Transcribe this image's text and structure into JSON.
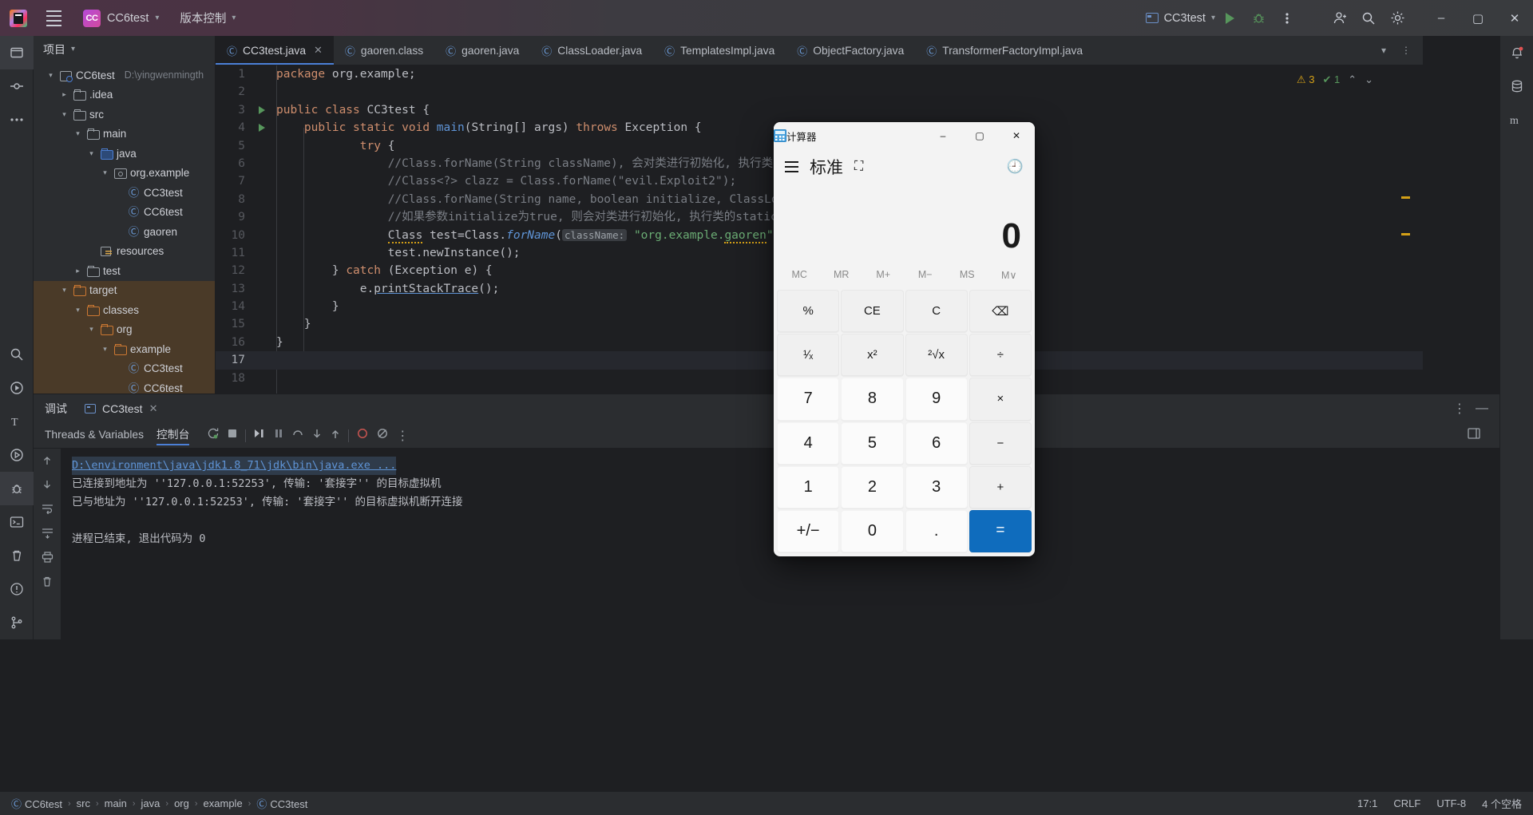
{
  "titlebar": {
    "project_badge": "CC",
    "project_name": "CC6test",
    "vcs_label": "版本控制",
    "run_config": "CC3test",
    "icons": {
      "menu": "hamburger-icon",
      "run": "run-icon",
      "debug": "debug-icon",
      "more": "more-vertical-icon",
      "account": "account-icon",
      "search": "search-icon",
      "settings": "gear-icon",
      "minimize": "–",
      "maximize": "▢",
      "close": "✕"
    }
  },
  "project_panel": {
    "header": "项目",
    "tree": [
      {
        "indent": 0,
        "arrow": "v",
        "icon": "module",
        "label": "CC6test",
        "sub": "D:\\yingwenmingth",
        "highlight": false
      },
      {
        "indent": 1,
        "arrow": ">",
        "icon": "folder",
        "label": ".idea",
        "sub": "",
        "highlight": false
      },
      {
        "indent": 1,
        "arrow": "v",
        "icon": "folder",
        "label": "src",
        "sub": "",
        "highlight": false
      },
      {
        "indent": 2,
        "arrow": "v",
        "icon": "folder",
        "label": "main",
        "sub": "",
        "highlight": false
      },
      {
        "indent": 3,
        "arrow": "v",
        "icon": "folder-blue",
        "label": "java",
        "sub": "",
        "highlight": false
      },
      {
        "indent": 4,
        "arrow": "v",
        "icon": "package",
        "label": "org.example",
        "sub": "",
        "highlight": false
      },
      {
        "indent": 5,
        "arrow": "",
        "icon": "class",
        "label": "CC3test",
        "sub": "",
        "highlight": false
      },
      {
        "indent": 5,
        "arrow": "",
        "icon": "class",
        "label": "CC6test",
        "sub": "",
        "highlight": false
      },
      {
        "indent": 5,
        "arrow": "",
        "icon": "class",
        "label": "gaoren",
        "sub": "",
        "highlight": false
      },
      {
        "indent": 3,
        "arrow": "",
        "icon": "resources",
        "label": "resources",
        "sub": "",
        "highlight": false
      },
      {
        "indent": 2,
        "arrow": ">",
        "icon": "folder",
        "label": "test",
        "sub": "",
        "highlight": false
      },
      {
        "indent": 1,
        "arrow": "v",
        "icon": "folder-orange",
        "label": "target",
        "sub": "",
        "highlight": true
      },
      {
        "indent": 2,
        "arrow": "v",
        "icon": "folder-orange",
        "label": "classes",
        "sub": "",
        "highlight": true
      },
      {
        "indent": 3,
        "arrow": "v",
        "icon": "folder-orange",
        "label": "org",
        "sub": "",
        "highlight": true
      },
      {
        "indent": 4,
        "arrow": "v",
        "icon": "folder-orange",
        "label": "example",
        "sub": "",
        "highlight": true
      },
      {
        "indent": 5,
        "arrow": "",
        "icon": "class",
        "label": "CC3test",
        "sub": "",
        "highlight": true
      },
      {
        "indent": 5,
        "arrow": "",
        "icon": "class",
        "label": "CC6test",
        "sub": "",
        "highlight": true
      }
    ]
  },
  "editor": {
    "tabs": [
      {
        "label": "CC3test.java",
        "active": true,
        "closable": true
      },
      {
        "label": "gaoren.class",
        "active": false,
        "closable": false
      },
      {
        "label": "gaoren.java",
        "active": false,
        "closable": false
      },
      {
        "label": "ClassLoader.java",
        "active": false,
        "closable": false
      },
      {
        "label": "TemplatesImpl.java",
        "active": false,
        "closable": false
      },
      {
        "label": "ObjectFactory.java",
        "active": false,
        "closable": false
      },
      {
        "label": "TransformerFactoryImpl.java",
        "active": false,
        "closable": false
      }
    ],
    "inspections": {
      "warnings": "3",
      "checks": "1"
    },
    "lines": [
      {
        "n": "1",
        "run": false,
        "html": "<span class=\"k\">package</span> org.example;"
      },
      {
        "n": "2",
        "run": false,
        "html": ""
      },
      {
        "n": "3",
        "run": true,
        "html": "<span class=\"k\">public class</span> CC3test {"
      },
      {
        "n": "4",
        "run": true,
        "html": "    <span class=\"k\">public static void</span> <span class=\"kb\">main</span>(String[] args) <span class=\"k\">throws</span> Exception {"
      },
      {
        "n": "5",
        "run": false,
        "html": "            <span class=\"k\">try</span> {"
      },
      {
        "n": "6",
        "run": false,
        "html": "                <span class=\"cm\">//Class.forName(String className), 会对类进行初始化, 执行类的static代码块</span>"
      },
      {
        "n": "7",
        "run": false,
        "html": "                <span class=\"cm\">//Class&lt;?&gt; clazz = Class.forName(\"evil.Exploit2\");</span>"
      },
      {
        "n": "8",
        "run": false,
        "html": "                <span class=\"cm\">//Class.forName(String name, boolean initialize, ClassLoader loader)</span>"
      },
      {
        "n": "9",
        "run": false,
        "html": "                <span class=\"cm\">//如果参数initialize为true, 则会对类进行初始化, 执行类的static代码块</span>"
      },
      {
        "n": "10",
        "run": false,
        "html": "                <span class=\"uwave\">Class</span> test=Class.<i class=\"kb\">forName</i>(<span class=\"hint\">className:</span> <span class=\"s\">\"org.example.<span class=\"uwave\">gaoren</span>\"</span>);"
      },
      {
        "n": "11",
        "run": false,
        "html": "                test.newInstance();"
      },
      {
        "n": "12",
        "run": false,
        "html": "        } <span class=\"k\">catch</span> (Exception e) {"
      },
      {
        "n": "13",
        "run": false,
        "html": "            e.<span class=\"uline\">printStackTrace</span>();"
      },
      {
        "n": "14",
        "run": false,
        "html": "        }"
      },
      {
        "n": "15",
        "run": false,
        "html": "    }"
      },
      {
        "n": "16",
        "run": false,
        "html": "}"
      },
      {
        "n": "17",
        "run": false,
        "html": "",
        "current": true
      },
      {
        "n": "18",
        "run": false,
        "html": ""
      }
    ]
  },
  "bottom_panel": {
    "debug_label": "调试",
    "session_tab": "CC3test",
    "subtabs": [
      {
        "label": "Threads & Variables",
        "active": false
      },
      {
        "label": "控制台",
        "active": true
      }
    ],
    "console_lines": [
      {
        "text": "D:\\environment\\java\\jdk1.8_71\\jdk\\bin\\java.exe ...",
        "style": "link"
      },
      {
        "text": "已连接到地址为 ''127.0.0.1:52253', 传输: '套接字'' 的目标虚拟机",
        "style": "normal"
      },
      {
        "text": "已与地址为 ''127.0.0.1:52253', 传输: '套接字'' 的目标虚拟机断开连接",
        "style": "normal"
      },
      {
        "text": "",
        "style": "normal"
      },
      {
        "text": "进程已结束, 退出代码为 0",
        "style": "normal"
      }
    ]
  },
  "status_bar": {
    "breadcrumbs": [
      "CC6test",
      "src",
      "main",
      "java",
      "org",
      "example",
      "CC3test"
    ],
    "caret": "17:1",
    "line_sep": "CRLF",
    "encoding": "UTF-8",
    "indent": "4 个空格"
  },
  "calculator": {
    "window_title": "计算器",
    "mode": "标准",
    "display_value": "0",
    "memory": [
      "MC",
      "MR",
      "M+",
      "M−",
      "MS",
      "M∨"
    ],
    "buttons": [
      {
        "label": "%",
        "type": "op"
      },
      {
        "label": "CE",
        "type": "op"
      },
      {
        "label": "C",
        "type": "op"
      },
      {
        "label": "⌫",
        "type": "op"
      },
      {
        "label": "¹∕ₓ",
        "type": "op"
      },
      {
        "label": "x²",
        "type": "op"
      },
      {
        "label": "²√x",
        "type": "op"
      },
      {
        "label": "÷",
        "type": "op"
      },
      {
        "label": "7",
        "type": "num"
      },
      {
        "label": "8",
        "type": "num"
      },
      {
        "label": "9",
        "type": "num"
      },
      {
        "label": "×",
        "type": "op"
      },
      {
        "label": "4",
        "type": "num"
      },
      {
        "label": "5",
        "type": "num"
      },
      {
        "label": "6",
        "type": "num"
      },
      {
        "label": "−",
        "type": "op"
      },
      {
        "label": "1",
        "type": "num"
      },
      {
        "label": "2",
        "type": "num"
      },
      {
        "label": "3",
        "type": "num"
      },
      {
        "label": "+",
        "type": "op"
      },
      {
        "label": "+/−",
        "type": "num"
      },
      {
        "label": "0",
        "type": "num"
      },
      {
        "label": ".",
        "type": "num"
      },
      {
        "label": "=",
        "type": "eq"
      }
    ],
    "window_controls": {
      "minimize": "–",
      "maximize": "▢",
      "close": "✕"
    }
  },
  "colors": {
    "accent_blue": "#4b7fd6",
    "calc_accent": "#0f6cbd",
    "target_highlight": "#4a3a28",
    "editor_bg": "#1e1f22",
    "panel_bg": "#2b2d30"
  }
}
